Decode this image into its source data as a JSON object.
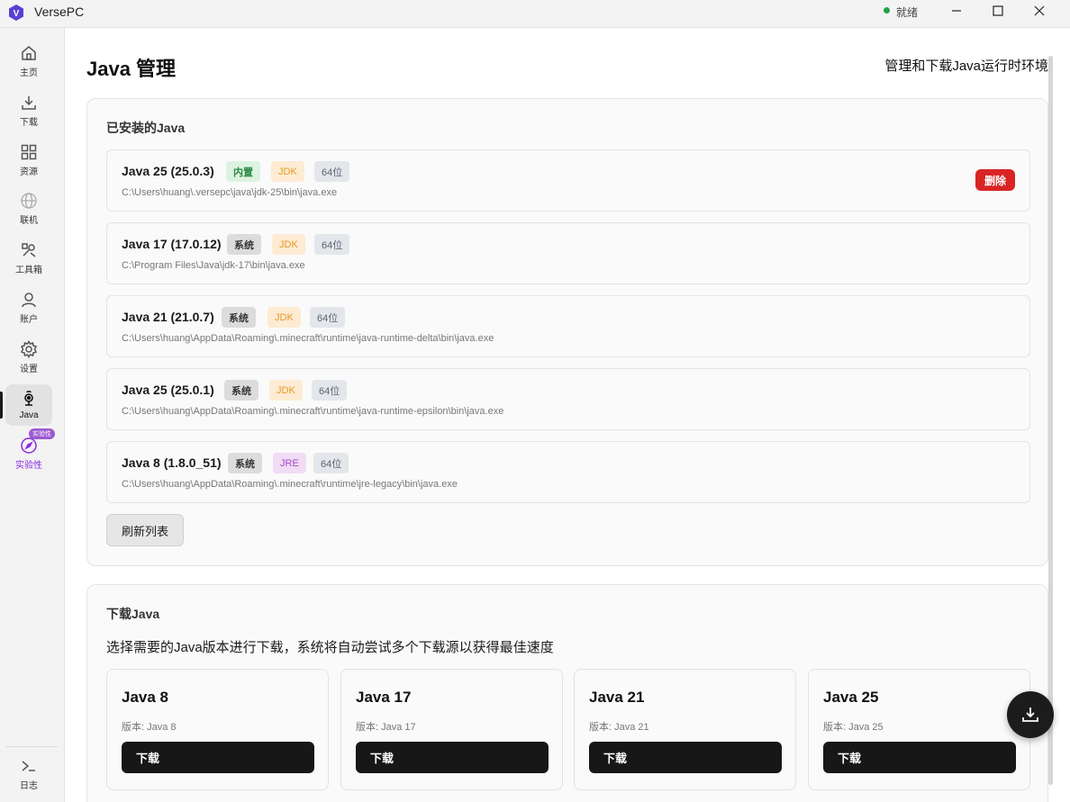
{
  "window": {
    "app_name": "VersePC",
    "logo_letter": "V",
    "status": "就绪",
    "status_color": "#22a34a",
    "controls": [
      "minimize-icon",
      "maximize-icon",
      "close-icon"
    ]
  },
  "sidebar": {
    "items": [
      {
        "label": "主页",
        "icon": "home-icon"
      },
      {
        "label": "下载",
        "icon": "download-icon"
      },
      {
        "label": "资源",
        "icon": "grid-icon"
      },
      {
        "label": "联机",
        "icon": "globe-icon"
      },
      {
        "label": "工具箱",
        "icon": "toolbox-icon"
      },
      {
        "label": "账户",
        "icon": "user-icon"
      },
      {
        "label": "设置",
        "icon": "gear-icon"
      },
      {
        "label": "Java",
        "icon": "java-icon",
        "active": true
      },
      {
        "label": "实验性",
        "icon": "compass-icon",
        "badge": "实验性"
      }
    ],
    "log": {
      "label": "日志",
      "icon": "terminal-icon"
    }
  },
  "page": {
    "title": "Java 管理",
    "subtitle": "管理和下载Java运行时环境"
  },
  "installed": {
    "title": "已安装的Java",
    "items": [
      {
        "name": "Java 25 (25.0.3)",
        "source": "内置",
        "type": "JDK",
        "bits": "64位",
        "path": "C:\\Users\\huang\\.versepc\\java\\jdk-25\\bin\\java.exe",
        "delete_label": "删除"
      },
      {
        "name": "Java 17 (17.0.12)",
        "source": "系统",
        "type": "JDK",
        "bits": "64位",
        "path": "C:\\Program Files\\Java\\jdk-17\\bin\\java.exe"
      },
      {
        "name": "Java 21 (21.0.7)",
        "source": "系统",
        "type": "JDK",
        "bits": "64位",
        "path": "C:\\Users\\huang\\AppData\\Roaming\\.minecraft\\runtime\\java-runtime-delta\\bin\\java.exe"
      },
      {
        "name": "Java 25 (25.0.1)",
        "source": "系统",
        "type": "JDK",
        "bits": "64位",
        "path": "C:\\Users\\huang\\AppData\\Roaming\\.minecraft\\runtime\\java-runtime-epsilon\\bin\\java.exe"
      },
      {
        "name": "Java 8 (1.8.0_51)",
        "source": "系统",
        "type": "JRE",
        "bits": "64位",
        "path": "C:\\Users\\huang\\AppData\\Roaming\\.minecraft\\runtime\\jre-legacy\\bin\\java.exe"
      }
    ],
    "refresh_label": "刷新列表"
  },
  "download": {
    "title": "下载Java",
    "description": "选择需要的Java版本进行下载，系统将自动尝试多个下载源以获得最佳速度",
    "versions": [
      {
        "name": "Java 8",
        "version": "版本: Java 8",
        "button": "下载"
      },
      {
        "name": "Java 17",
        "version": "版本: Java 17",
        "button": "下载"
      },
      {
        "name": "Java 21",
        "version": "版本: Java 21",
        "button": "下载"
      },
      {
        "name": "Java 25",
        "version": "版本: Java 25",
        "button": "下载"
      }
    ]
  },
  "fab": {
    "icon": "download-tray-icon"
  },
  "colors": {
    "accent_dark": "#171717",
    "danger": "#d92424",
    "builtin_tag": "#2a8a44",
    "jdk_tag": "#e59a22",
    "jre_tag": "#a748c8",
    "experimental": "#8a2be2"
  }
}
